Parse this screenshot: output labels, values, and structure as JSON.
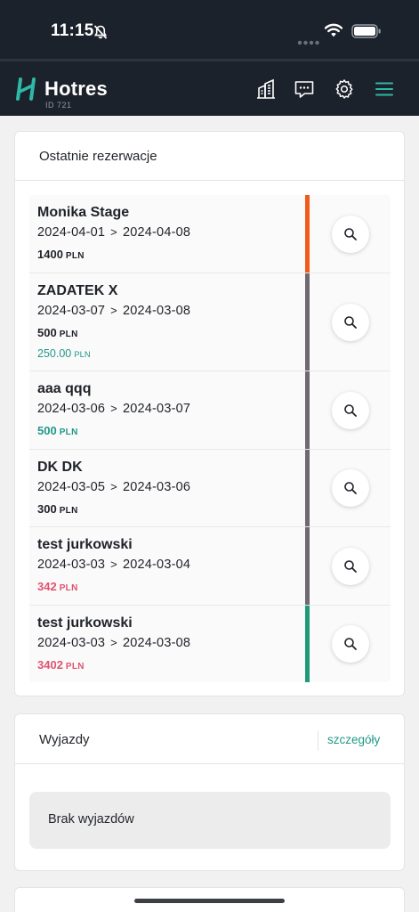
{
  "status_bar": {
    "time": "11:15",
    "icons": [
      "bell-off-icon",
      "signal-dots-icon",
      "wifi-icon",
      "battery-icon"
    ]
  },
  "header": {
    "app_name": "Hotres",
    "account_id": "ID 721",
    "icons": [
      "building-icon",
      "messages-icon",
      "gear-icon",
      "menu-icon"
    ],
    "accent_color": "#2fb8a6"
  },
  "recent_reservations": {
    "title": "Ostatnie rezerwacje",
    "items": [
      {
        "name": "Monika Stage",
        "date_from": "2024-04-01",
        "date_to": "2024-04-08",
        "amount": "1400",
        "currency": "PLN",
        "amount_color": "#1f2229",
        "bar_color": "#f25a1c"
      },
      {
        "name": "ZADATEK X",
        "date_from": "2024-03-07",
        "date_to": "2024-03-08",
        "amount": "500",
        "currency": "PLN",
        "amount_color": "#1f2229",
        "paid": "250.00",
        "paid_currency": "PLN",
        "bar_color": "#6e6a70"
      },
      {
        "name": "aaa qqq",
        "date_from": "2024-03-06",
        "date_to": "2024-03-07",
        "amount": "500",
        "currency": "PLN",
        "amount_color": "#21998a",
        "bar_color": "#6e6a70"
      },
      {
        "name": "DK DK",
        "date_from": "2024-03-05",
        "date_to": "2024-03-06",
        "amount": "300",
        "currency": "PLN",
        "amount_color": "#1f2229",
        "bar_color": "#6e6a70"
      },
      {
        "name": "test jurkowski",
        "date_from": "2024-03-03",
        "date_to": "2024-03-04",
        "amount": "342",
        "currency": "PLN",
        "amount_color": "#e0536f",
        "bar_color": "#6e6a70"
      },
      {
        "name": "test jurkowski",
        "date_from": "2024-03-03",
        "date_to": "2024-03-08",
        "amount": "3402",
        "currency": "PLN",
        "amount_color": "#e0536f",
        "bar_color": "#1f9a78"
      }
    ]
  },
  "departures": {
    "title": "Wyjazdy",
    "details_link": "szczegóły",
    "empty_text": "Brak wyjazdów"
  }
}
